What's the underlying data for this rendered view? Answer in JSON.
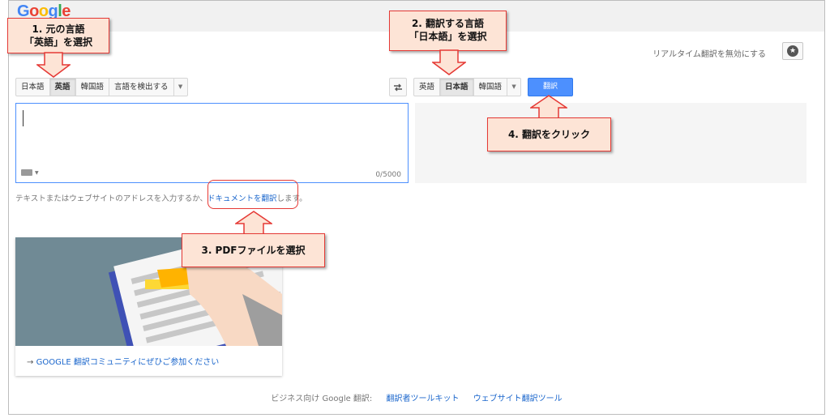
{
  "header": {
    "logo_letters": [
      {
        "ch": "G",
        "color": "#4285f4"
      },
      {
        "ch": "o",
        "color": "#ea4335"
      },
      {
        "ch": "o",
        "color": "#fbbc05"
      },
      {
        "ch": "g",
        "color": "#4285f4"
      },
      {
        "ch": "l",
        "color": "#34a853"
      },
      {
        "ch": "e",
        "color": "#ea4335"
      }
    ],
    "realtime_link": "リアルタイム翻訳を無効にする",
    "star_icon": "star-icon"
  },
  "source": {
    "languages": [
      "日本語",
      "英語",
      "韓国語",
      "言語を検出する"
    ],
    "active_index": 1,
    "char_count": "0/5000",
    "keyboard_icon": "keyboard-icon"
  },
  "target": {
    "languages": [
      "英語",
      "日本語",
      "韓国語"
    ],
    "active_index": 1,
    "translate_label": "翻訳"
  },
  "hint": {
    "prefix": "テキストまたはウェブサイトのアドレスを入力するか、",
    "link": "ドキュメントを翻訳",
    "suffix": "します。"
  },
  "community": {
    "link": "GOOGLE 翻訳コミュニティにぜひご参加ください"
  },
  "footer": {
    "prefix": "ビジネス向け Google 翻訳:",
    "link1": "翻訳者ツールキット",
    "link2": "ウェブサイト翻訳ツール"
  },
  "callouts": {
    "c1_line1": "1. 元の言語",
    "c1_line2": "「英語」を選択",
    "c2_line1": "2.  翻訳する言語",
    "c2_line2": "「日本語」を選択",
    "c3": "3.  PDFファイルを選択",
    "c4": "4.  翻訳をクリック"
  },
  "colors": {
    "accent": "#4d90fe",
    "callout_border": "#e53935",
    "callout_fill": "#fde4d6"
  }
}
